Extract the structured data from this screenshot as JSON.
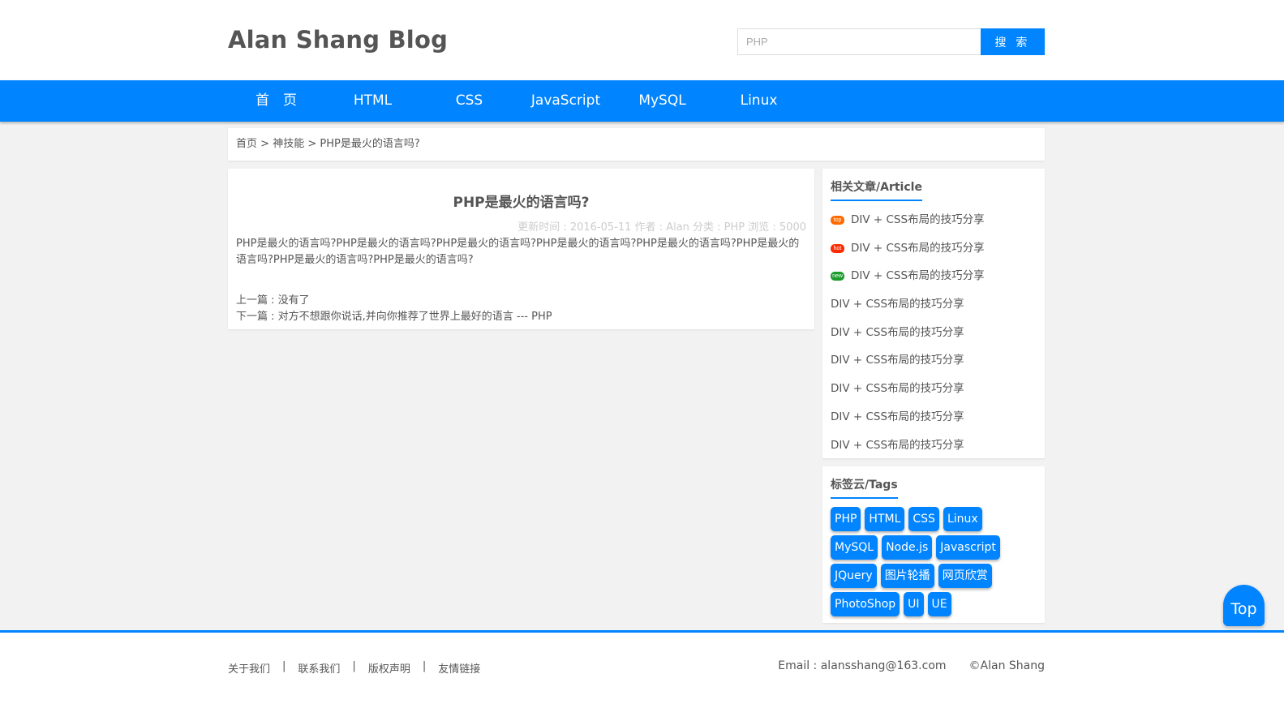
{
  "header": {
    "logo": "Alan Shang Blog",
    "search_placeholder": "PHP",
    "search_button": "搜 索"
  },
  "nav": {
    "items": [
      "首　页",
      "HTML",
      "CSS",
      "JavaScript",
      "MySQL",
      "Linux"
    ]
  },
  "breadcrumb": {
    "home": "首页",
    "sep": ">",
    "category": "神技能",
    "current": "PHP是最火的语言吗?"
  },
  "article": {
    "title": "PHP是最火的语言吗?",
    "meta": "更新时间 : 2016-05-11 作者 : Alan 分类 : PHP 浏览 : 5000",
    "content": "PHP是最火的语言吗?PHP是最火的语言吗?PHP是最火的语言吗?PHP是最火的语言吗?PHP是最火的语言吗?PHP是最火的语言吗?PHP是最火的语言吗?PHP是最火的语言吗?",
    "prev_label": "上一篇 : ",
    "prev": "没有了",
    "next_label": "下一篇 : ",
    "next": "对方不想跟你说话,并向你推荐了世界上最好的语言 --- PHP"
  },
  "related": {
    "title": "相关文章/Article",
    "items": [
      {
        "badge": "top",
        "badge_color": "#ff6a00",
        "text": "DIV + CSS布局的技巧分享"
      },
      {
        "badge": "hot",
        "badge_color": "#ff2a00",
        "text": "DIV + CSS布局的技巧分享"
      },
      {
        "badge": "new",
        "badge_color": "#1a9c2b",
        "text": "DIV + CSS布局的技巧分享"
      },
      {
        "badge": "",
        "text": "DIV + CSS布局的技巧分享"
      },
      {
        "badge": "",
        "text": "DIV + CSS布局的技巧分享"
      },
      {
        "badge": "",
        "text": "DIV + CSS布局的技巧分享"
      },
      {
        "badge": "",
        "text": "DIV + CSS布局的技巧分享"
      },
      {
        "badge": "",
        "text": "DIV + CSS布局的技巧分享"
      },
      {
        "badge": "",
        "text": "DIV + CSS布局的技巧分享"
      }
    ]
  },
  "tags": {
    "title": "标签云/Tags",
    "items": [
      "PHP",
      "HTML",
      "CSS",
      "Linux",
      "MySQL",
      "Node.js",
      "Javascript",
      "JQuery",
      "图片轮播",
      "网页欣赏",
      "PhotoShop",
      "UI",
      "UE"
    ]
  },
  "footer": {
    "links": [
      "关于我们",
      "联系我们",
      "版权声明",
      "友情链接"
    ],
    "separator": "|",
    "email": "Email : alansshang@163.com",
    "copyright": "©Alan Shang"
  },
  "top_button": "Top",
  "colors": {
    "accent": "#0084ff",
    "background": "#f2f2f2"
  }
}
